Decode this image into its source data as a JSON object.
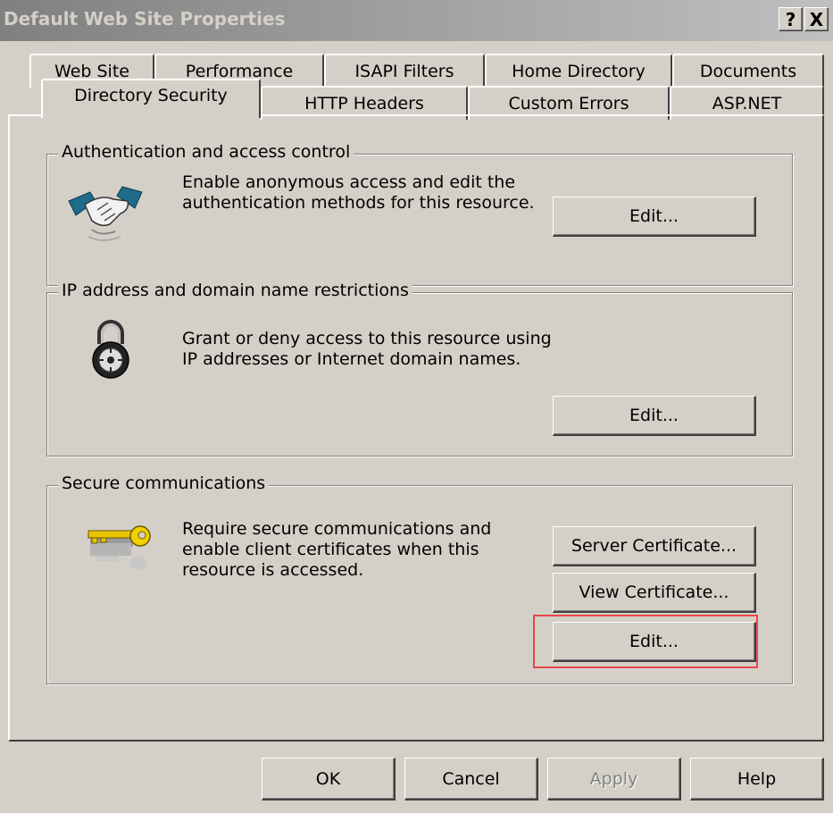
{
  "window": {
    "title": "Default Web Site Properties",
    "help_glyph": "?",
    "close_glyph": "X"
  },
  "tabs": {
    "row1": [
      "Web Site",
      "Performance",
      "ISAPI Filters",
      "Home Directory",
      "Documents"
    ],
    "row2": [
      "Directory Security",
      "HTTP Headers",
      "Custom Errors",
      "ASP.NET"
    ],
    "active": "Directory Security"
  },
  "auth": {
    "legend": "Authentication and access control",
    "line1": "Enable anonymous access and edit the",
    "line2": "authentication methods for this resource.",
    "edit": "Edit...",
    "icon": "handshake-icon"
  },
  "ip": {
    "legend": "IP address and domain name restrictions",
    "line1": "Grant or deny access to this resource using",
    "line2": "IP addresses or Internet domain names.",
    "edit": "Edit...",
    "icon": "padlock-icon"
  },
  "secure": {
    "legend": "Secure communications",
    "line1": "Require secure communications and",
    "line2": "enable client certificates when this",
    "line3": "resource is accessed.",
    "server_cert": "Server Certificate...",
    "view_cert": "View Certificate...",
    "edit": "Edit...",
    "icon": "key-icon",
    "highlight_color": "#e8474c"
  },
  "footer": {
    "ok": "OK",
    "cancel": "Cancel",
    "apply": "Apply",
    "help": "Help"
  },
  "colors": {
    "face": "#d4d0c8",
    "title_gradient_start": "#808080",
    "title_gradient_end": "#c0c0c0"
  }
}
